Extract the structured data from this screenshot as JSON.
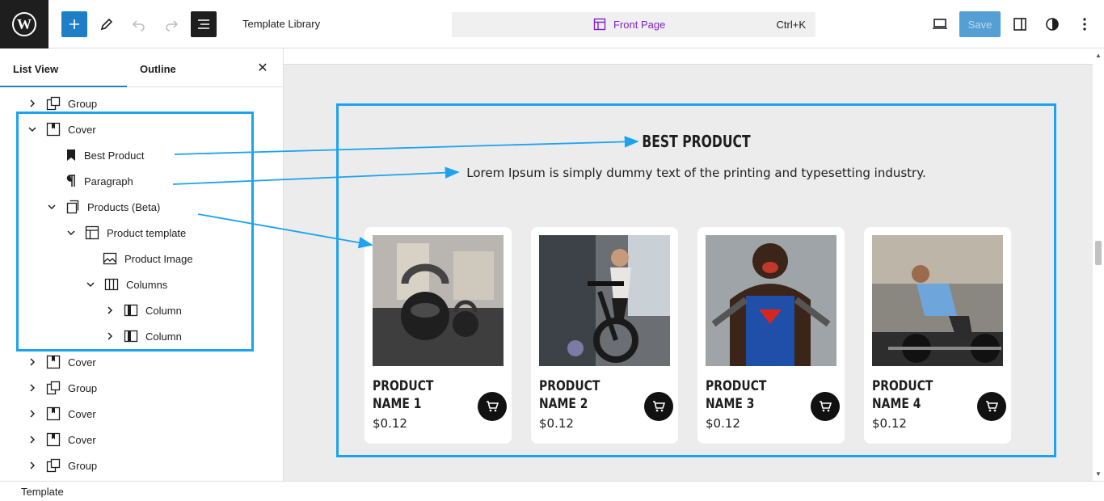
{
  "topbar": {
    "doc_title": "Template Library",
    "command_label": "Front Page",
    "command_shortcut": "Ctrl+K",
    "save_label": "Save"
  },
  "sidebar": {
    "tabs": [
      {
        "label": "List View"
      },
      {
        "label": "Outline"
      }
    ],
    "items": [
      {
        "label": "Group",
        "icon": "group-icon",
        "expanded": false
      },
      {
        "label": "Cover",
        "icon": "cover-icon",
        "expanded": true
      },
      {
        "label": "Best Product",
        "icon": "bookmark-icon"
      },
      {
        "label": "Paragraph",
        "icon": "paragraph-icon"
      },
      {
        "label": "Products (Beta)",
        "icon": "products-icon",
        "expanded": true
      },
      {
        "label": "Product template",
        "icon": "template-icon",
        "expanded": true
      },
      {
        "label": "Product Image",
        "icon": "image-icon"
      },
      {
        "label": "Columns",
        "icon": "columns-icon",
        "expanded": true
      },
      {
        "label": "Column",
        "icon": "column-icon",
        "expanded": false
      },
      {
        "label": "Column",
        "icon": "column-icon",
        "expanded": false
      },
      {
        "label": "Cover",
        "icon": "cover-icon",
        "expanded": false
      },
      {
        "label": "Group",
        "icon": "group-icon",
        "expanded": false
      },
      {
        "label": "Cover",
        "icon": "cover-icon",
        "expanded": false
      },
      {
        "label": "Cover",
        "icon": "cover-icon",
        "expanded": false
      },
      {
        "label": "Group",
        "icon": "group-icon",
        "expanded": false
      }
    ]
  },
  "canvas": {
    "heading": "BEST PRODUCT",
    "paragraph": "Lorem Ipsum is simply dummy text of the printing and typesetting industry.",
    "products": [
      {
        "name": "PRODUCT NAME 1",
        "price": "$0.12"
      },
      {
        "name": "PRODUCT NAME 2",
        "price": "$0.12"
      },
      {
        "name": "PRODUCT NAME 3",
        "price": "$0.12"
      },
      {
        "name": "PRODUCT NAME 4",
        "price": "$0.12"
      }
    ]
  },
  "status": {
    "label": "Template"
  },
  "colors": {
    "accent": "#1e7fc6",
    "highlight": "#1ba3f0",
    "command": "#7e24c6"
  }
}
